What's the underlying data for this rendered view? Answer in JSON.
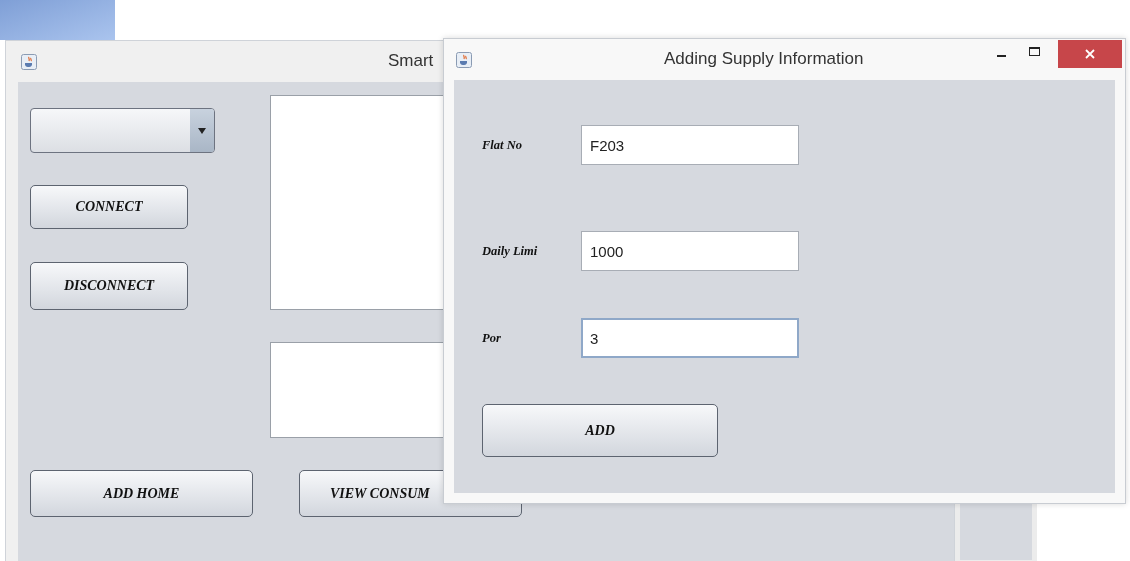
{
  "main_window": {
    "title": "Smart",
    "buttons": [
      {
        "label": "CONNECT"
      },
      {
        "label": "DISCONNECT"
      }
    ],
    "bottom_buttons": [
      {
        "label": "ADD HOME"
      },
      {
        "label": "VIEW CONSUM"
      }
    ]
  },
  "dialog": {
    "title": "Adding Supply Information",
    "fields": [
      {
        "label": "Flat No",
        "value": "F203",
        "focused": false
      },
      {
        "label": "Daily Limi",
        "value": "1000",
        "focused": false
      },
      {
        "label": "Por",
        "value": "3",
        "focused": true
      }
    ],
    "button": "ADD"
  }
}
